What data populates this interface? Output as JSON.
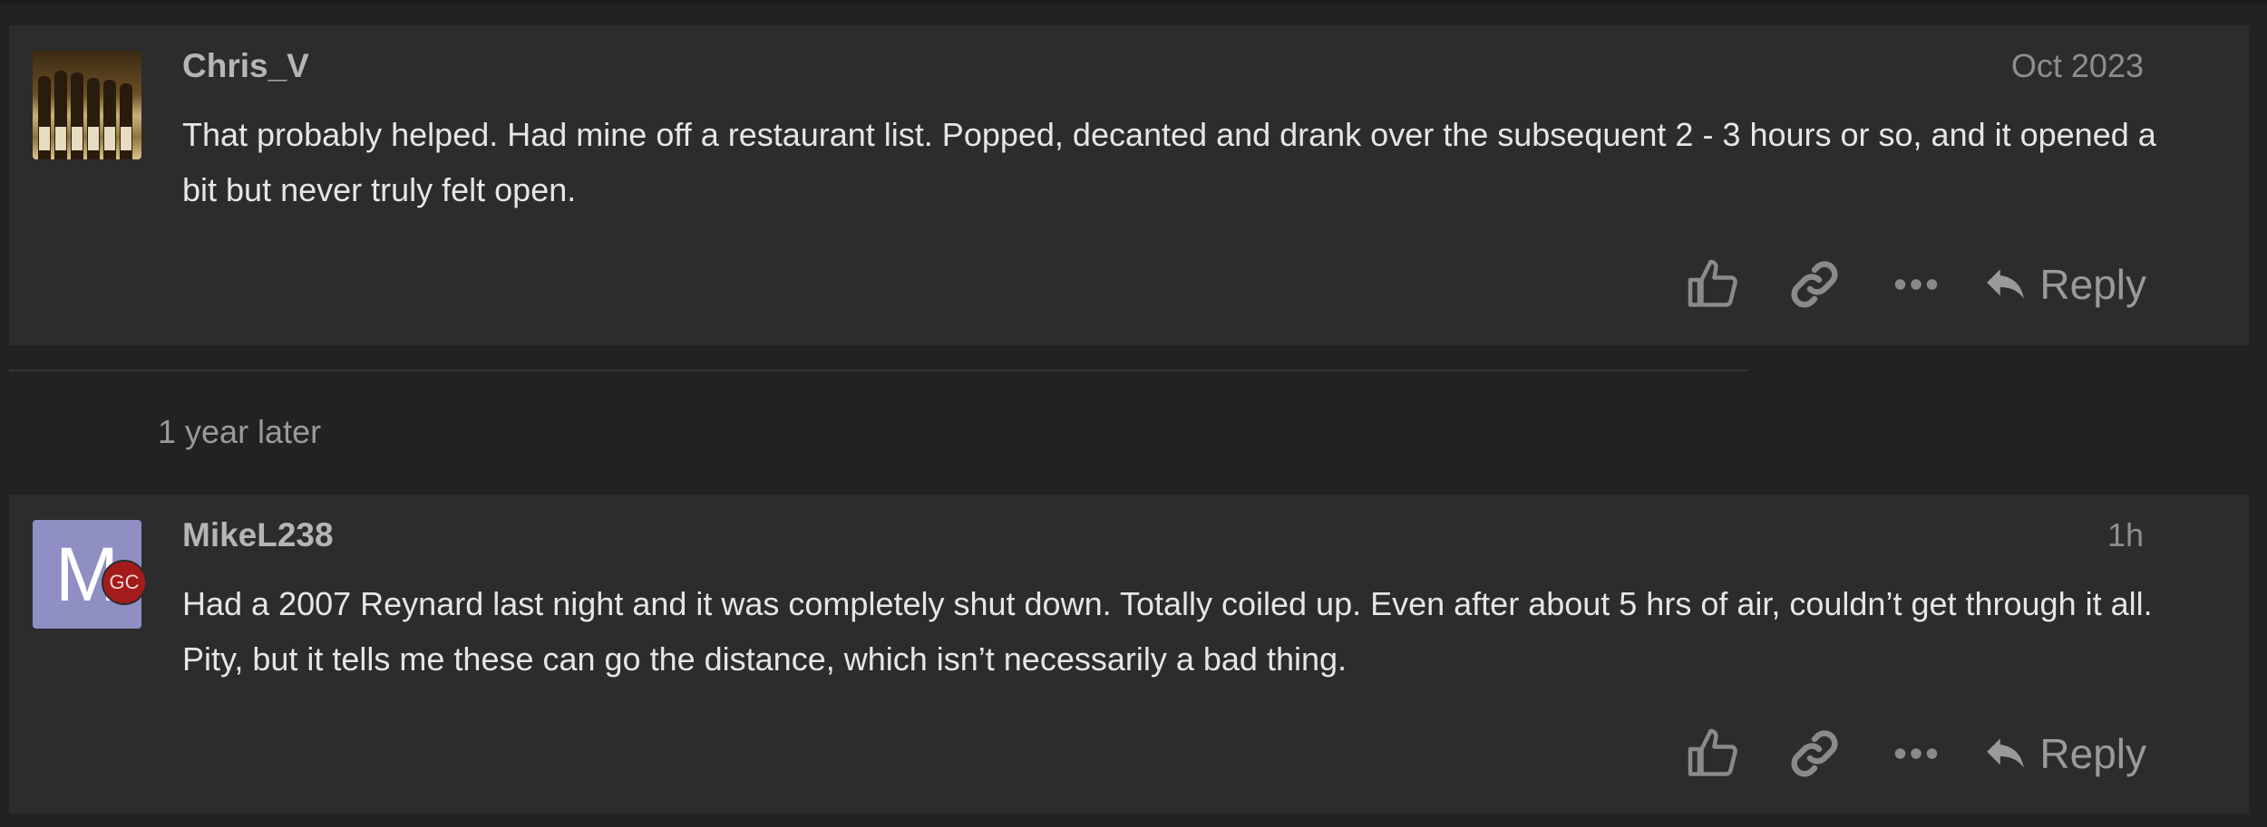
{
  "posts": [
    {
      "author": "Chris_V",
      "date": "Oct 2023",
      "body": "That probably helped. Had mine off a restaurant list. Popped, decanted and drank over the subsequent 2 - 3 hours or so, and it opened a bit but never truly felt open.",
      "avatar": "photo-of-wine-bottles",
      "actions": {
        "like_icon": "thumbs-up-icon",
        "link_icon": "link-icon",
        "more_icon": "ellipsis-icon",
        "reply_label": "Reply"
      }
    },
    {
      "author": "MikeL238",
      "date": "1h",
      "body": "Had a 2007 Reynard last night and it was completely shut down. Totally coiled up. Even after about 5 hrs of air, couldn’t get through it all. Pity, but it tells me these can go the distance, which isn’t necessarily a bad thing.",
      "avatar_letter": "M",
      "avatar_color": "#8f8fc4",
      "flair": "GC",
      "flair_color": "#a31b1b",
      "actions": {
        "like_icon": "thumbs-up-icon",
        "link_icon": "link-icon",
        "more_icon": "ellipsis-icon",
        "reply_label": "Reply"
      }
    }
  ],
  "time_gap": "1 year later",
  "colors": {
    "background": "#222222",
    "post_background": "#2c2c2c",
    "text": "#e6e6e6",
    "muted": "#8e8e8e"
  }
}
